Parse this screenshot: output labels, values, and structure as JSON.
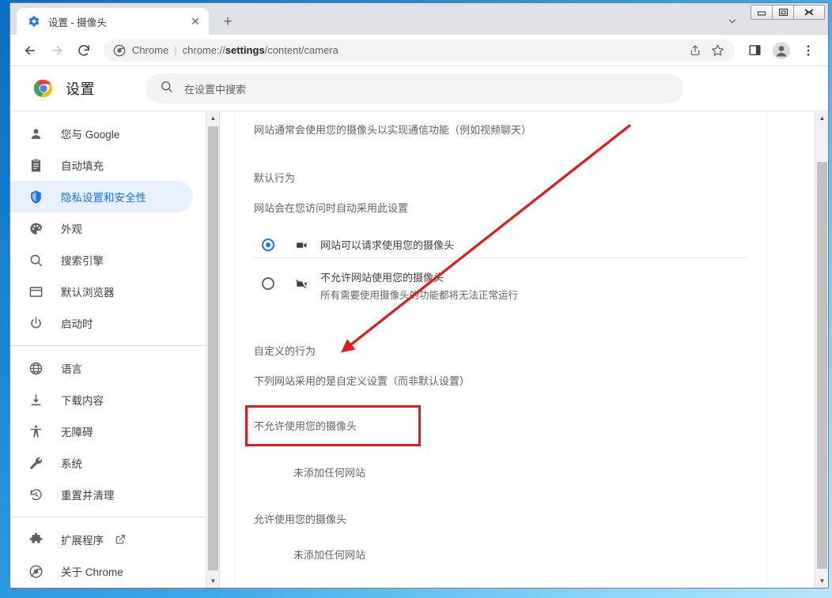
{
  "window": {
    "caption": {
      "minimize": "—",
      "maximize": "❐",
      "close": "✕"
    }
  },
  "tabstrip": {
    "tab_title": "设置 - 摄像头",
    "favicon": "settings-gear-icon",
    "close_label": "✕",
    "newtab_label": "+",
    "tabsearch_icon": "chevron-down-icon"
  },
  "toolbar": {
    "back_icon": "back-arrow-icon",
    "forward_icon": "forward-arrow-icon",
    "reload_icon": "reload-icon",
    "omnibox": {
      "scheme_label": "Chrome",
      "separator": "|",
      "url_prefix": "chrome://",
      "url_bold": "settings",
      "url_suffix": "/content/camera",
      "full_url": "chrome://settings/content/camera"
    },
    "share_icon": "share-icon",
    "bookmark_icon": "star-icon",
    "sidepanel_icon": "side-panel-icon",
    "profile_icon": "profile-avatar-icon",
    "menu_icon": "three-dot-menu-icon"
  },
  "settings_header": {
    "logo": "chrome-logo-icon",
    "title": "设置",
    "search_icon": "search-icon",
    "search_placeholder": "在设置中搜索",
    "search_value": ""
  },
  "sidebar": {
    "groups": [
      {
        "items": [
          {
            "label": "您与 Google",
            "icon": "person-icon",
            "active": false
          },
          {
            "label": "自动填充",
            "icon": "clipboard-icon",
            "active": false
          },
          {
            "label": "隐私设置和安全性",
            "icon": "shield-icon",
            "active": true
          },
          {
            "label": "外观",
            "icon": "palette-icon",
            "active": false
          },
          {
            "label": "搜索引擎",
            "icon": "search-icon",
            "active": false
          },
          {
            "label": "默认浏览器",
            "icon": "browser-window-icon",
            "active": false
          },
          {
            "label": "启动时",
            "icon": "power-icon",
            "active": false
          }
        ]
      },
      {
        "items": [
          {
            "label": "语言",
            "icon": "globe-icon",
            "active": false
          },
          {
            "label": "下载内容",
            "icon": "download-icon",
            "active": false
          },
          {
            "label": "无障碍",
            "icon": "accessibility-icon",
            "active": false
          },
          {
            "label": "系统",
            "icon": "wrench-icon",
            "active": false
          },
          {
            "label": "重置并清理",
            "icon": "history-restore-icon",
            "active": false
          }
        ]
      },
      {
        "items": [
          {
            "label": "扩展程序",
            "icon": "puzzle-icon",
            "active": false,
            "external": true
          },
          {
            "label": "关于 Chrome",
            "icon": "chrome-outline-icon",
            "active": false
          }
        ]
      }
    ]
  },
  "main": {
    "intro": "网站通常会使用您的摄像头以实现通信功能（例如视频聊天）",
    "default_behavior_title": "默认行为",
    "default_behavior_sub": "网站会在您访问时自动采用此设置",
    "options": [
      {
        "label": "网站可以请求使用您的摄像头",
        "desc": "",
        "icon": "camera-icon",
        "selected": true
      },
      {
        "label": "不允许网站使用您的摄像头",
        "desc": "所有需要使用摄像头的功能都将无法正常运行",
        "icon": "camera-off-icon",
        "selected": false
      }
    ],
    "custom_behavior_title": "自定义的行为",
    "custom_behavior_sub": "下列网站采用的是自定义设置（而非默认设置）",
    "groups": [
      {
        "title": "不允许使用您的摄像头",
        "empty": "未添加任何网站",
        "highlighted": true
      },
      {
        "title": "允许使用您的摄像头",
        "empty": "未添加任何网站",
        "highlighted": false
      }
    ]
  },
  "annotation": {
    "arrow_color": "#e01b1b",
    "highlight_color": "#e01b1b"
  },
  "scrollbars": {
    "up_arrow": "▲",
    "down_arrow": "▼"
  }
}
